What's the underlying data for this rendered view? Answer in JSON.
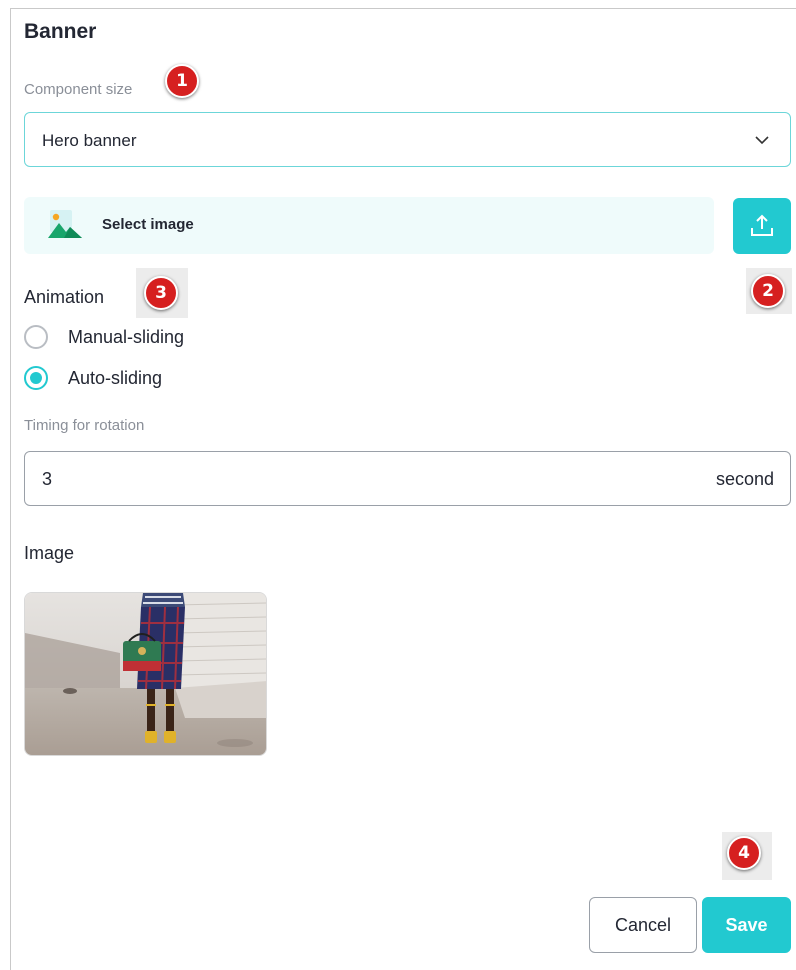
{
  "panel": {
    "title": "Banner"
  },
  "component_size": {
    "label": "Component size",
    "selected": "Hero banner"
  },
  "image_picker": {
    "label": "Select image"
  },
  "animation": {
    "label": "Animation",
    "options": [
      {
        "label": "Manual-sliding",
        "checked": false
      },
      {
        "label": "Auto-sliding",
        "checked": true
      }
    ]
  },
  "timing": {
    "label": "Timing for rotation",
    "value": "3",
    "unit": "second"
  },
  "image_section": {
    "label": "Image"
  },
  "actions": {
    "cancel": "Cancel",
    "save": "Save"
  },
  "badges": {
    "b1": "1",
    "b2": "2",
    "b3": "3",
    "b4": "4"
  },
  "colors": {
    "accent": "#22c9d0",
    "badge": "#d62020",
    "picker_bg": "#effbfb"
  }
}
